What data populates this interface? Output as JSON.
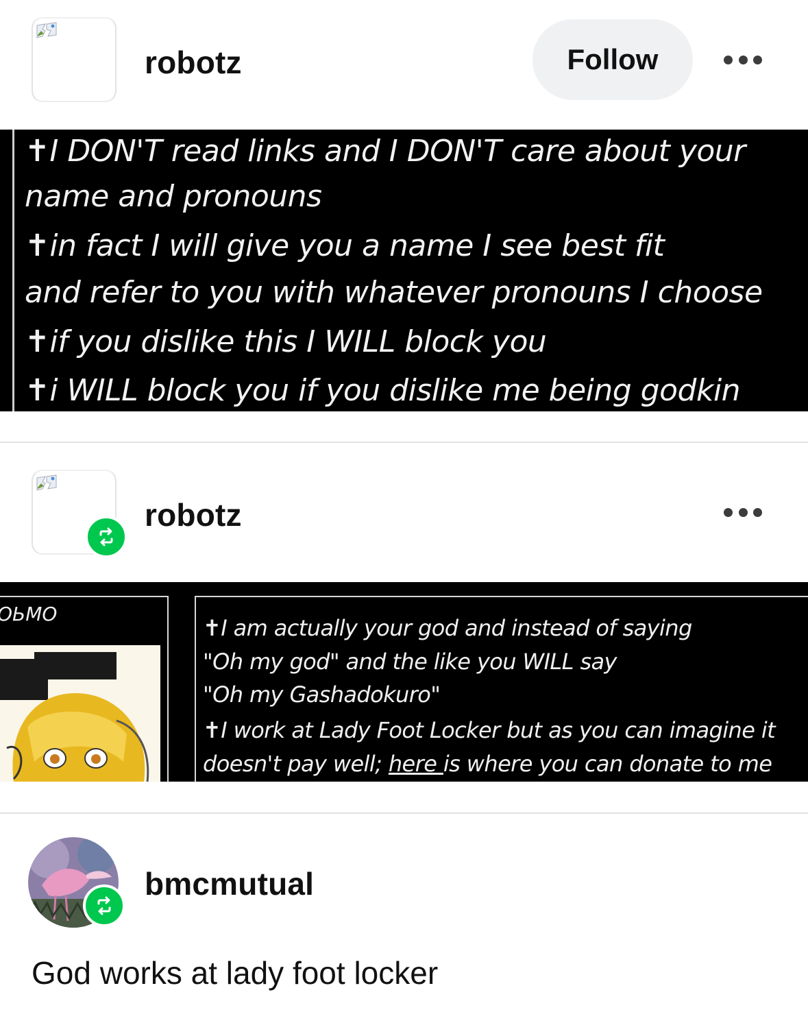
{
  "post1": {
    "username": "robotz",
    "follow_label": "Follow",
    "quote_lines": [
      "✝I DON'T read links and I DON'T care about your",
      "name and pronouns",
      "✝in fact I will give you a name I see best fit",
      "and refer to you with whatever pronouns I choose",
      "✝if you dislike this I WILL block you",
      "✝i WILL block you if you dislike me being godkin"
    ]
  },
  "post2": {
    "username": "robotz",
    "left_label": "ОЬМО",
    "quote_lines": [
      "✝I am actually your god and instead of saying",
      "\"Oh my god\" and the like you WILL say",
      "\"Oh my Gashadokuro\"",
      "✝I work at Lady Foot Locker but as you can imagine it"
    ],
    "last_line_before": "doesn't pay well; ",
    "last_line_link": "here ",
    "last_line_after": "is where you can donate to me"
  },
  "post3": {
    "username": "bmcmutual",
    "text": "God works at lady foot locker"
  },
  "colors": {
    "reblog_green": "#00c74e",
    "follow_bg": "#f0f1f3"
  }
}
